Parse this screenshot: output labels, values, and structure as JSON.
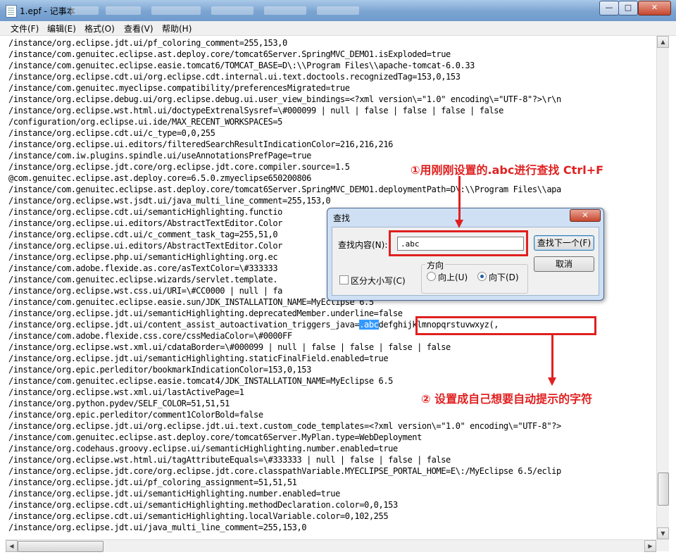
{
  "window": {
    "title": "1.epf - 记事本",
    "minimize": "—",
    "maximize": "□",
    "close": "✕"
  },
  "menu": [
    "文件(F)",
    "编辑(E)",
    "格式(O)",
    "查看(V)",
    "帮助(H)"
  ],
  "lines": [
    "/instance/org.eclipse.jdt.ui/pf_coloring_comment=255,153,0",
    "/instance/com.genuitec.eclipse.ast.deploy.core/tomcat6Server.SpringMVC_DEMO1.isExploded=true",
    "/instance/com.genuitec.eclipse.easie.tomcat6/TOMCAT_BASE=D\\:\\\\Program Files\\\\apache-tomcat-6.0.33",
    "/instance/org.eclipse.cdt.ui/org.eclipse.cdt.internal.ui.text.doctools.recognizedTag=153,0,153",
    "/instance/com.genuitec.myeclipse.compatibility/preferencesMigrated=true",
    "/instance/org.eclipse.debug.ui/org.eclipse.debug.ui.user_view_bindings=<?xml version\\=\"1.0\" encoding\\=\"UTF-8\"?>\\r\\n",
    "/instance/org.eclipse.wst.html.ui/doctypeExtrenalSysref=\\#000099 | null | false | false | false | false",
    "/configuration/org.eclipse.ui.ide/MAX_RECENT_WORKSPACES=5",
    "/instance/org.eclipse.cdt.ui/c_type=0,0,255",
    "/instance/org.eclipse.ui.editors/filteredSearchResultIndicationColor=216,216,216",
    "/instance/com.iw.plugins.spindle.ui/useAnnotationsPrefPage=true",
    "/instance/org.eclipse.jdt.core/org.eclipse.jdt.core.compiler.source=1.5",
    "@com.genuitec.eclipse.ast.deploy.core=6.5.0.zmyeclipse650200806",
    "/instance/com.genuitec.eclipse.ast.deploy.core/tomcat6Server.SpringMVC_DEMO1.deploymentPath=D\\:\\\\Program Files\\\\apa",
    "/instance/org.eclipse.wst.jsdt.ui/java_multi_line_comment=255,153,0",
    "/instance/org.eclipse.cdt.ui/semanticHighlighting.functio",
    "/instance/org.eclipse.ui.editors/AbstractTextEditor.Color",
    "/instance/org.eclipse.cdt.ui/c_comment_task_tag=255,51,0",
    "/instance/org.eclipse.ui.editors/AbstractTextEditor.Color",
    "/instance/org.eclipse.php.ui/semanticHighlighting.org.ec                                                   edHighlig",
    "/instance/com.adobe.flexide.as.core/asTextColor=\\#333333",
    "/instance/com.genuitec.eclipse.wizards/servlet.template.",
    "/instance/org.eclipse.wst.css.ui/URI=\\#CC0000 | null | fa",
    "/instance/com.genuitec.eclipse.easie.sun/JDK_INSTALLATION_NAME=MyEclipse 6.5",
    "/instance/org.eclipse.jdt.ui/semanticHighlighting.deprecatedMember.underline=false",
    "/instance/org.eclipse.jdt.ui/content_assist_autoactivation_triggers_java=",
    "/instance/com.adobe.flexide.css.core/cssMediaColor=\\#0000FF",
    "/instance/org.eclipse.wst.xml.ui/cdataBorder=\\#000099 | null | false | false | false | false",
    "/instance/org.eclipse.jdt.ui/semanticHighlighting.staticFinalField.enabled=true",
    "/instance/org.epic.perleditor/bookmarkIndicationColor=153,0,153",
    "/instance/com.genuitec.eclipse.easie.tomcat4/JDK_INSTALLATION_NAME=MyEclipse 6.5",
    "/instance/org.eclipse.wst.xml.ui/lastActivePage=1",
    "/instance/org.python.pydev/SELF_COLOR=51,51,51",
    "/instance/org.epic.perleditor/comment1ColorBold=false",
    "/instance/org.eclipse.jdt.ui/org.eclipse.jdt.ui.text.custom_code_templates=<?xml version\\=\"1.0\" encoding\\=\"UTF-8\"?>",
    "/instance/com.genuitec.eclipse.ast.deploy.core/tomcat6Server.MyPlan.type=WebDeployment",
    "/instance/org.codehaus.groovy.eclipse.ui/semanticHighlighting.number.enabled=true",
    "/instance/org.eclipse.wst.html.ui/tagAttributeEquals=\\#333333 | null | false | false | false",
    "/instance/org.eclipse.jdt.core/org.eclipse.jdt.core.classpathVariable.MYECLIPSE_PORTAL_HOME=E\\:/MyEclipse 6.5/eclip",
    "/instance/org.eclipse.jdt.ui/pf_coloring_assignment=51,51,51",
    "/instance/org.eclipse.jdt.ui/semanticHighlighting.number.enabled=true",
    "/instance/org.eclipse.cdt.ui/semanticHighlighting.methodDeclaration.color=0,0,153",
    "/instance/org.eclipse.cdt.ui/semanticHighlighting.localVariable.color=0,102,255",
    "/instance/org.eclipse.jdt.ui/java_multi_line_comment=255,153,0"
  ],
  "selected_text": ".abc",
  "after_selection": "defghijklmnopqrstuvwxyz(,",
  "dialog": {
    "title": "查找",
    "find_label": "查找内容(N):",
    "find_value": ".abc",
    "find_next": "查找下一个(F)",
    "cancel": "取消",
    "match_case": "区分大小写(C)",
    "direction_label": "方向",
    "up": "向上(U)",
    "down": "向下(D)",
    "close": "✕",
    "direction_selected": "down"
  },
  "annotations": {
    "step1": "①用刚刚设置的.abc进行查找 Ctrl+F",
    "step2": "② 设置成自己想要自动提示的字符"
  },
  "colors": {
    "annotation": "#e02020",
    "selection": "#3399ff"
  }
}
